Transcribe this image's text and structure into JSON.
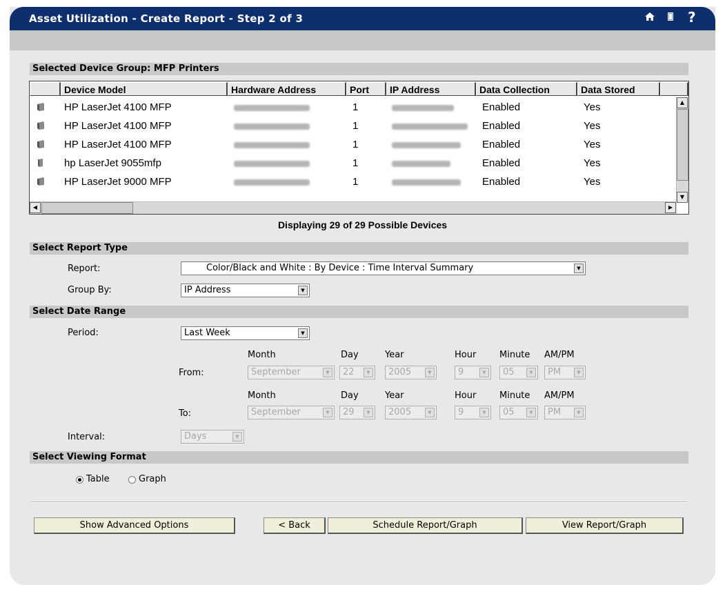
{
  "window": {
    "title": "Asset Utilization - Create Report - Step 2 of 3"
  },
  "device_section": {
    "header": "Selected Device Group: MFP Printers",
    "columns": [
      "Device Model",
      "Hardware Address",
      "Port",
      "IP Address",
      "Data Collection",
      "Data Stored"
    ],
    "rows": [
      {
        "model": "HP LaserJet 4100 MFP",
        "port": "1",
        "collection": "Enabled",
        "stored": "Yes"
      },
      {
        "model": "HP LaserJet 4100 MFP",
        "port": "1",
        "collection": "Enabled",
        "stored": "Yes"
      },
      {
        "model": "HP LaserJet 4100 MFP",
        "port": "1",
        "collection": "Enabled",
        "stored": "Yes"
      },
      {
        "model": "hp LaserJet 9055mfp",
        "port": "1",
        "collection": "Enabled",
        "stored": "Yes"
      },
      {
        "model": "HP LaserJet 9000 MFP",
        "port": "1",
        "collection": "Enabled",
        "stored": "Yes"
      }
    ],
    "count_text": "Displaying 29 of 29 Possible Devices"
  },
  "report_type": {
    "header": "Select Report Type",
    "report_label": "Report:",
    "report_value": "Color/Black and White : By Device : Time Interval Summary",
    "group_label": "Group By:",
    "group_value": "IP Address"
  },
  "date_range": {
    "header": "Select Date Range",
    "period_label": "Period:",
    "period_value": "Last Week",
    "col_month": "Month",
    "col_day": "Day",
    "col_year": "Year",
    "col_hour": "Hour",
    "col_minute": "Minute",
    "col_ampm": "AM/PM",
    "from_label": "From:",
    "from": {
      "month": "September",
      "day": "22",
      "year": "2005",
      "hour": "9",
      "minute": "05",
      "ampm": "PM"
    },
    "to_label": "To:",
    "to": {
      "month": "September",
      "day": "29",
      "year": "2005",
      "hour": "9",
      "minute": "05",
      "ampm": "PM"
    },
    "interval_label": "Interval:",
    "interval_value": "Days"
  },
  "viewing_format": {
    "header": "Select Viewing Format",
    "options": [
      "Table",
      "Graph"
    ],
    "selected": "Table"
  },
  "buttons": {
    "advanced": "Show Advanced Options",
    "back": "< Back",
    "schedule": "Schedule Report/Graph",
    "view": "View Report/Graph"
  },
  "icons": [
    "home-icon",
    "book-icon",
    "help-icon",
    "printer-icon"
  ],
  "colors": {
    "title_bar": "#0e2f6e",
    "panel": "#e8e8e8",
    "section_header": "#c8c8c8",
    "button": "#f0efd9"
  }
}
